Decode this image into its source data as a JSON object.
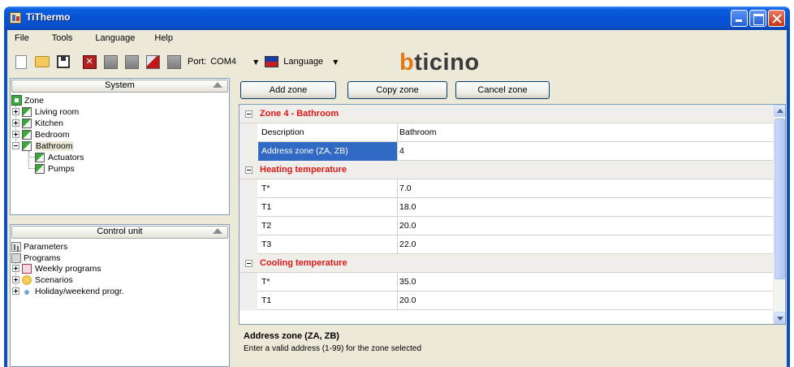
{
  "window": {
    "title": "TiThermo"
  },
  "menu": [
    "File",
    "Tools",
    "Language",
    "Help"
  ],
  "toolbar": {
    "port_label": "Port:",
    "port_value": "COM4",
    "language_label": "Language",
    "brand": "bticino",
    "buttons": [
      "new-file-icon",
      "open-folder-icon",
      "save-icon",
      "delete-icon",
      "receive-icon",
      "send-icon",
      "transmit-icon",
      "print-icon"
    ]
  },
  "system_panel": {
    "header": "System",
    "root": "Zone",
    "zones": [
      "Living room",
      "Kitchen",
      "Bedroom",
      "Bathroom"
    ],
    "bathroom_children": [
      "Actuators",
      "Pumps"
    ]
  },
  "control_panel": {
    "header": "Control unit",
    "items": [
      "Parameters",
      "Programs",
      "Weekly programs",
      "Scenarios",
      "Holiday/weekend progr."
    ]
  },
  "actions": [
    "Add zone",
    "Copy zone",
    "Cancel zone"
  ],
  "grid": {
    "zone_category": "Zone 4 - Bathroom",
    "zone_props": [
      {
        "name": "Description",
        "value": "Bathroom"
      },
      {
        "name": "Address zone (ZA, ZB)",
        "value": "4"
      }
    ],
    "heating_category": "Heating temperature",
    "heating_props": [
      {
        "name": "T*",
        "value": "7.0"
      },
      {
        "name": "T1",
        "value": "18.0"
      },
      {
        "name": "T2",
        "value": "20.0"
      },
      {
        "name": "T3",
        "value": "22.0"
      }
    ],
    "cooling_category": "Cooling temperature",
    "cooling_props": [
      {
        "name": "T*",
        "value": "35.0"
      },
      {
        "name": "T1",
        "value": "20.0"
      }
    ]
  },
  "description": {
    "title": "Address zone (ZA, ZB)",
    "text": "Enter a valid address (1-99) for the zone selected"
  },
  "colors": {
    "category_text": "#e01717",
    "selection": "#316ac5",
    "title_bar": "#0753d6"
  }
}
